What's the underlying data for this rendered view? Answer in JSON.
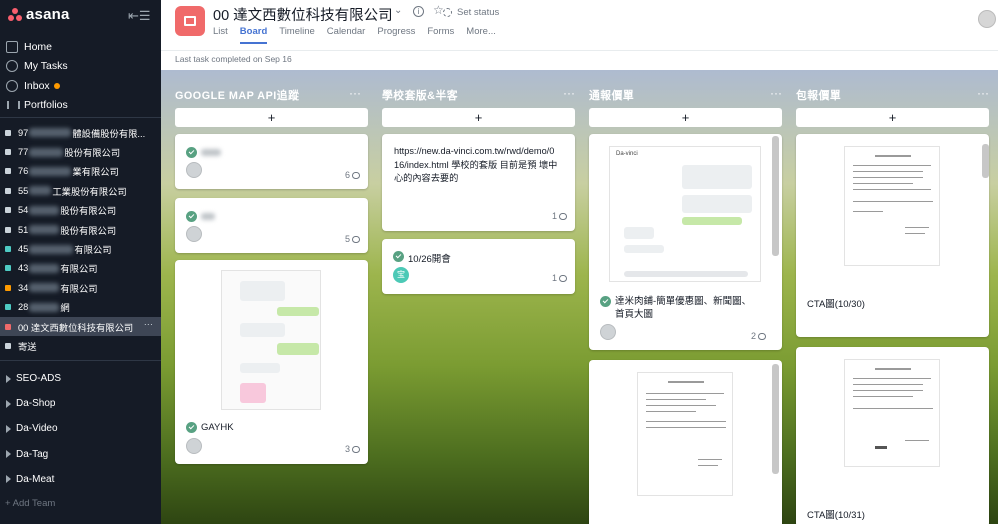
{
  "sidebar": {
    "logo_text": "asana",
    "nav": [
      {
        "label": "Home",
        "icon": "home-icon"
      },
      {
        "label": "My Tasks",
        "icon": "check-circle-icon"
      },
      {
        "label": "Inbox",
        "icon": "bell-icon"
      },
      {
        "label": "Portfolios",
        "icon": "bar-chart-icon"
      }
    ],
    "projects": [
      {
        "label_start": "97",
        "label_end": "體設備股份有限...",
        "color": "#cbd4db"
      },
      {
        "label_start": "77",
        "label_end": "股份有限公司",
        "color": "#cbd4db"
      },
      {
        "label_start": "76",
        "label_end": "業有限公司",
        "color": "#cbd4db"
      },
      {
        "label_start": "55",
        "label_end": "工業股份有限公司",
        "color": "#cbd4db"
      },
      {
        "label_start": "54",
        "label_end": "股份有限公司",
        "color": "#cbd4db"
      },
      {
        "label_start": "51",
        "label_end": "股份有限公司",
        "color": "#cbd4db"
      },
      {
        "label_start": "45",
        "label_end": "有限公司",
        "color": "#4ecbc4"
      },
      {
        "label_start": "43",
        "label_end": "有限公司",
        "color": "#4ecbc4"
      },
      {
        "label_start": "34",
        "label_end": "有限公司",
        "color": "#fd9a00"
      },
      {
        "label_start": "28",
        "label_end": "網",
        "color": "#4ecbc4"
      },
      {
        "label_start": "00 達文西數位科技有限公司",
        "label_end": "",
        "color": "#f06a6a",
        "active": true
      },
      {
        "label_start": "寄送",
        "label_end": "",
        "color": "#cbd4db"
      }
    ],
    "teams": [
      "SEO-ADS",
      "Da-Shop",
      "Da-Video",
      "Da-Tag",
      "Da-Meat"
    ],
    "add_team": "Add Team"
  },
  "header": {
    "project_title": "00 達文西數位科技有限公司",
    "set_status": "Set status",
    "tabs": [
      "List",
      "Board",
      "Timeline",
      "Calendar",
      "Progress",
      "Forms",
      "More..."
    ],
    "active_tab": "Board",
    "last_task": "Last task completed on Sep 16"
  },
  "columns": [
    {
      "title": "GOOGLE MAP API追蹤",
      "cards": [
        {
          "name": "",
          "comments": "6"
        },
        {
          "name": "",
          "comments": "5"
        },
        {
          "name": "GAYHK",
          "comments": "3"
        }
      ]
    },
    {
      "title": "學校套版&半客",
      "cards": [
        {
          "desc": "https://new.da-vinci.com.tw/rwd/demo/016/index.html 學校的套版 目前是預 壞中心的內容去要的",
          "comments": "1"
        },
        {
          "name": "10/26開會",
          "comments": "1",
          "avatar_text": "宝"
        }
      ]
    },
    {
      "title": "通報價單",
      "cards": [
        {
          "thumb_title": "Da-vinci",
          "name": "達米肉鋪-簡單優惠圖、新聞圖、首頁大圖",
          "comments": "2"
        },
        {
          "name": ""
        }
      ]
    },
    {
      "title": "包報價單",
      "cards": [
        {
          "name": "CTA圖(10/30)"
        },
        {
          "name": "CTA圖(10/31)"
        }
      ]
    }
  ],
  "colors": {
    "sidebar_bg": "#151b26",
    "accent": "#4573d2",
    "project_icon": "#f06a6a",
    "check": "#58a182"
  }
}
